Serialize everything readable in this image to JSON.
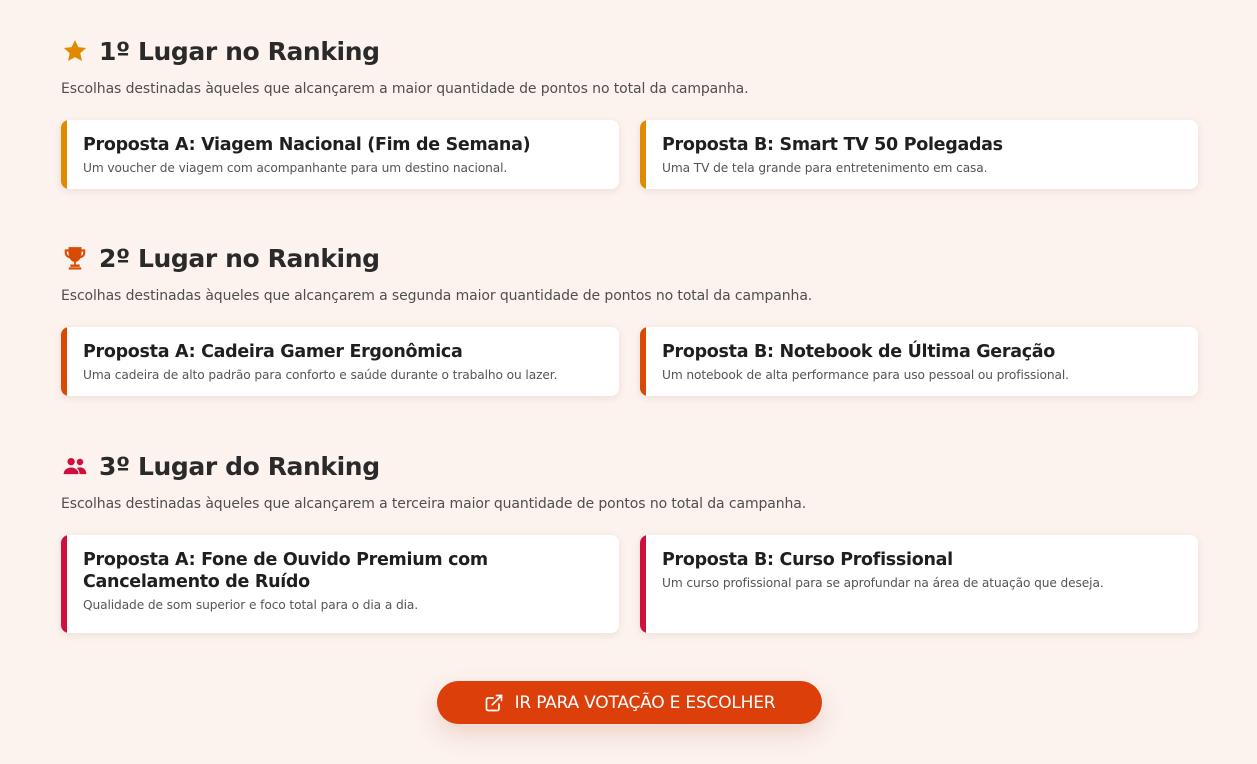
{
  "colors": {
    "background": "#fcf2ee",
    "first_accent": "#e08a00",
    "second_accent": "#d94a05",
    "third_accent": "#d0103c",
    "button": "#dd3f0b"
  },
  "sections": [
    {
      "icon": "star-icon",
      "title": "1º Lugar no Ranking",
      "description": "Escolhas destinadas àqueles que alcançarem a maior quantidade de pontos no total da campanha.",
      "options": [
        {
          "title": "Proposta A: Viagem Nacional (Fim de Semana)",
          "description": "Um voucher de viagem com acompanhante para um destino nacional."
        },
        {
          "title": "Proposta B: Smart TV 50 Polegadas",
          "description": "Uma TV de tela grande para entretenimento em casa."
        }
      ]
    },
    {
      "icon": "trophy-icon",
      "title": "2º Lugar no Ranking",
      "description": "Escolhas destinadas àqueles que alcançarem a segunda maior quantidade de pontos no total da campanha.",
      "options": [
        {
          "title": "Proposta A: Cadeira Gamer Ergonômica",
          "description": "Uma cadeira de alto padrão para conforto e saúde durante o trabalho ou lazer."
        },
        {
          "title": "Proposta B: Notebook de Última Geração",
          "description": "Um notebook de alta performance para uso pessoal ou profissional."
        }
      ]
    },
    {
      "icon": "users-icon",
      "title": "3º Lugar do Ranking",
      "description": "Escolhas destinadas àqueles que alcançarem a terceira maior quantidade de pontos no total da campanha.",
      "options": [
        {
          "title": "Proposta A: Fone de Ouvido Premium com Cancelamento de Ruído",
          "description": "Qualidade de som superior e foco total para o dia a dia."
        },
        {
          "title": "Proposta B: Curso Profissional",
          "description": "Um curso profissional para se aprofundar na área de atuação que deseja."
        }
      ]
    }
  ],
  "cta": {
    "icon": "external-link-icon",
    "label": "IR PARA VOTAÇÃO E ESCOLHER"
  }
}
